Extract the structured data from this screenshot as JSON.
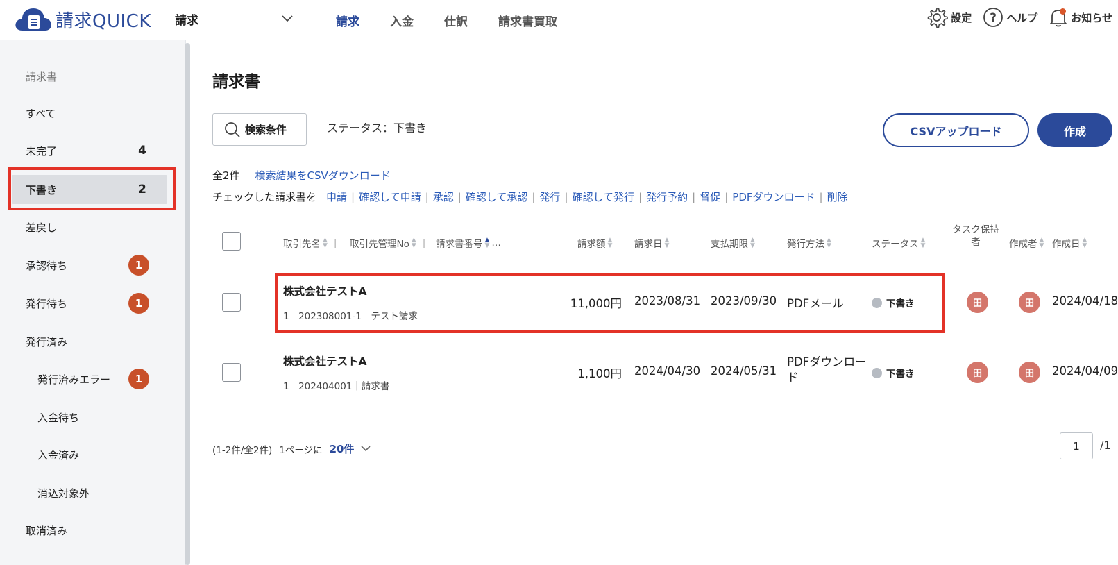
{
  "header": {
    "logo_text": "請求QUICK",
    "module": "請求",
    "nav": [
      {
        "label": "請求",
        "active": true
      },
      {
        "label": "入金",
        "active": false
      },
      {
        "label": "仕訳",
        "active": false
      },
      {
        "label": "請求書買取",
        "active": false
      }
    ],
    "settings_label": "設定",
    "help_label": "ヘルプ",
    "notice_label": "お知らせ"
  },
  "sidebar": {
    "heading": "請求書",
    "items": [
      {
        "label": "すべて"
      },
      {
        "label": "未完了",
        "count": "4"
      },
      {
        "label": "下書き",
        "count": "2"
      },
      {
        "label": "差戻し"
      },
      {
        "label": "承認待ち",
        "badge": "1"
      },
      {
        "label": "発行待ち",
        "badge": "1"
      },
      {
        "label": "発行済み"
      },
      {
        "label": "発行済みエラー",
        "badge": "1"
      },
      {
        "label": "入金待ち"
      },
      {
        "label": "入金済み"
      },
      {
        "label": "消込対象外"
      },
      {
        "label": "取消済み"
      }
    ]
  },
  "main": {
    "title": "請求書",
    "search_label": "検索条件",
    "status_filter": "ステータス：下書き",
    "csv_upload_label": "CSVアップロード",
    "create_label": "作成",
    "total": "全2件",
    "csv_download_link": "検索結果をCSVダウンロード",
    "bulk_lead": "チェックした請求書を",
    "bulk_actions": [
      "申請",
      "確認して申請",
      "承認",
      "確認して承認",
      "発行",
      "確認して発行",
      "発行予約",
      "督促",
      "PDFダウンロード",
      "削除"
    ]
  },
  "table": {
    "columns": {
      "client": "取引先名",
      "client_no": "取引先管理No",
      "invoice_no": "請求書番号",
      "more": "…",
      "amount": "請求額",
      "invoice_date": "請求日",
      "due_date": "支払期限",
      "method": "発行方法",
      "status": "ステータス",
      "task_holder": "タスク保持者",
      "creator": "作成者",
      "created_date": "作成日"
    },
    "rows": [
      {
        "client": "株式会社テストA",
        "sub": "1｜202308001-1｜テスト請求",
        "amount": "11,000円",
        "invoice_date": "2023/08/31",
        "due_date": "2023/09/30",
        "method": "PDFメール",
        "status": "下書き",
        "task_holder": "田",
        "creator": "田",
        "created_date": "2024/04/18"
      },
      {
        "client": "株式会社テストA",
        "sub": "1｜202404001｜請求書",
        "amount": "1,100円",
        "invoice_date": "2024/04/30",
        "due_date": "2024/05/31",
        "method": "PDFダウンロード",
        "status": "下書き",
        "task_holder": "田",
        "creator": "田",
        "created_date": "2024/04/09"
      }
    ]
  },
  "pagination": {
    "range": "(1-2件/全2件)",
    "per_page_label": "1ページに",
    "per_page": "20件",
    "current_page": "1",
    "total_pages": "/1"
  },
  "colors": {
    "brand": "#2b4a9a",
    "link": "#2b5bb8",
    "badge": "#c8502a",
    "avatar": "#d4766b",
    "highlight": "#e33227"
  }
}
